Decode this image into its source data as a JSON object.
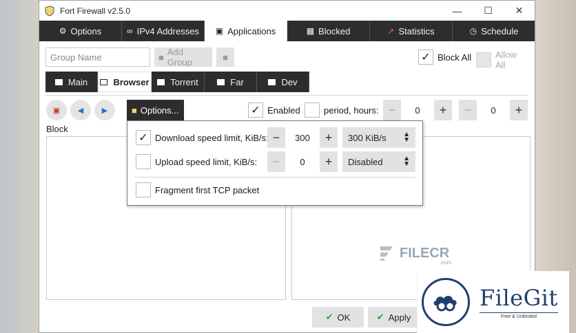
{
  "window": {
    "title": "Fort Firewall v2.5.0"
  },
  "tabs": [
    {
      "label": "Options",
      "icon": "gear-icon"
    },
    {
      "label": "IPv4 Addresses",
      "icon": "ip-icon"
    },
    {
      "label": "Applications",
      "icon": "window-icon"
    },
    {
      "label": "Blocked",
      "icon": "blocked-icon"
    },
    {
      "label": "Statistics",
      "icon": "chart-icon"
    },
    {
      "label": "Schedule",
      "icon": "clock-icon"
    }
  ],
  "group": {
    "name_placeholder": "Group Name",
    "add_group_label": "Add Group",
    "block_all_label": "Block All",
    "allow_all_label": "Allow All"
  },
  "subtabs": [
    "Main",
    "Browser",
    "Torrent",
    "Far",
    "Dev"
  ],
  "toolbar": {
    "options_label": "Options...",
    "enabled_label": "Enabled",
    "period_label": "period, hours:",
    "period_from": "0",
    "period_to": "0"
  },
  "block_label": "Block",
  "popup": {
    "download_label": "Download speed limit, KiB/s:",
    "download_value": "300",
    "download_combo": "300 KiB/s",
    "upload_label": "Upload speed limit, KiB/s:",
    "upload_value": "0",
    "upload_combo": "Disabled",
    "fragment_label": "Fragment first TCP packet"
  },
  "buttons": {
    "ok": "OK",
    "apply": "Apply"
  },
  "watermarks": {
    "filecr": "FILECR",
    "filecr_sub": ".com",
    "filegit_title": "FileGit",
    "filegit_sub": "Free & Unlimited"
  },
  "colors": {
    "dark_tab": "#2d2d2d",
    "accent_blue": "#2b6fd6",
    "filegit_navy": "#1f3f6b"
  }
}
